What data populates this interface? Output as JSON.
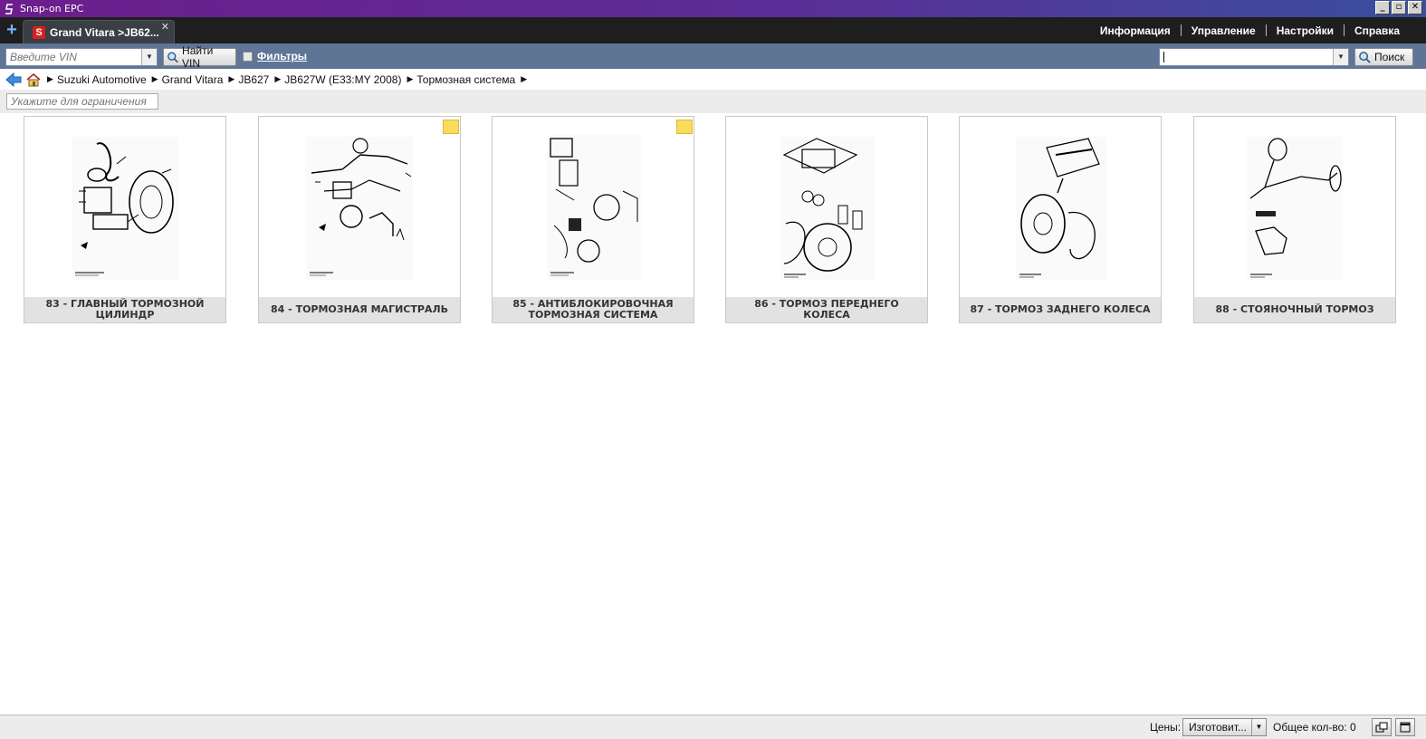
{
  "window": {
    "title": "Snap-on EPC",
    "controls": [
      "_",
      "▫",
      "✕"
    ]
  },
  "tabs": {
    "new_tab_icon": "plus-icon",
    "active_tab_label": "Grand Vitara >JB62..."
  },
  "top_menu": {
    "items": [
      "Информация",
      "Управление",
      "Настройки",
      "Справка"
    ]
  },
  "toolbar": {
    "vin_placeholder": "Введите VIN",
    "find_vin_label": "Найти VIN",
    "filters_label": "Фильтры",
    "search_value": "",
    "search_label": "Поиск"
  },
  "breadcrumb": {
    "items": [
      "Suzuki Automotive",
      "Grand Vitara",
      "JB627",
      "JB627W (E33:MY 2008)",
      "Тормозная система"
    ]
  },
  "filter": {
    "placeholder": "Укажите для ограничения"
  },
  "cards": [
    {
      "caption": "83 - ГЛАВНЫЙ ТОРМОЗНОЙ ЦИЛИНДР",
      "has_note": false
    },
    {
      "caption": "84 - ТОРМОЗНАЯ МАГИСТРАЛЬ",
      "has_note": true
    },
    {
      "caption": "85 - АНТИБЛОКИРОВОЧНАЯ ТОРМОЗНАЯ СИСТЕМА",
      "has_note": true
    },
    {
      "caption": "86 - ТОРМОЗ ПЕРЕДНЕГО КОЛЕСА",
      "has_note": false
    },
    {
      "caption": "87 - ТОРМОЗ ЗАДНЕГО КОЛЕСА",
      "has_note": false
    },
    {
      "caption": "88 - СТОЯНОЧНЫЙ ТОРМОЗ",
      "has_note": false
    }
  ],
  "status": {
    "prices_label": "Цены:",
    "prices_value": "Изготовит...",
    "total_label": "Общее кол-во: 0"
  },
  "colors": {
    "titlebar": "#6d1e8c",
    "tabbar": "#1e1e1e",
    "toolbar": "#5e7596",
    "note": "#f8dc5c"
  }
}
